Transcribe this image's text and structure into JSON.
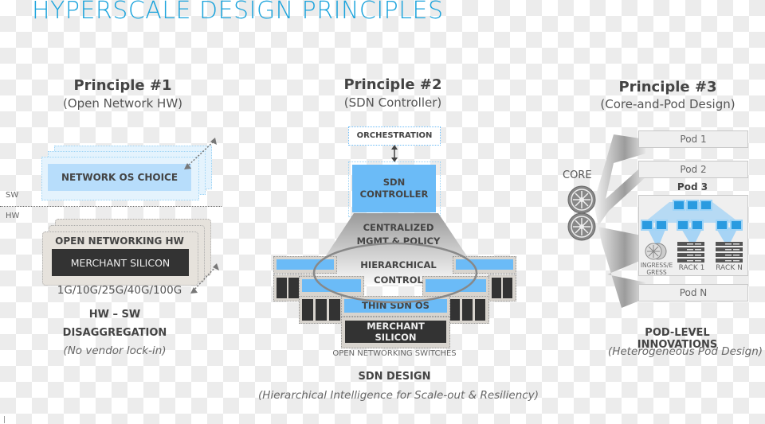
{
  "title": "HYPERSCALE DESIGN PRINCIPLES",
  "principle1": {
    "heading": "Principle #1",
    "subheading": "(Open Network HW)",
    "sw_label": "SW",
    "hw_label": "HW",
    "os_box": "NETWORK OS CHOICE",
    "hw_card": "OPEN NETWORKING HW",
    "silicon": "MERCHANT SILICON",
    "speeds": "1G/10G/25G/40G/100G",
    "caption_line1": "HW – SW",
    "caption_line2": "DISAGGREGATION",
    "note": "(No vendor lock-in)"
  },
  "principle2": {
    "heading": "Principle #2",
    "subheading": "(SDN Controller)",
    "orchestration": "ORCHESTRATION",
    "controller_line1": "SDN",
    "controller_line2": "CONTROLLER",
    "mgmt_line1": "CENTRALIZED",
    "mgmt_line2": "MGMT & POLICY",
    "control_line1": "HIERARCHICAL",
    "control_line2": "CONTROL",
    "thin_os": "THIN SDN OS",
    "silicon": "MERCHANT SILICON",
    "switches": "OPEN NETWORKING SWITCHES",
    "caption": "SDN DESIGN",
    "note": "(Hierarchical Intelligence for Scale-out & Resiliency)"
  },
  "principle3": {
    "heading": "Principle #3",
    "subheading": "(Core-and-Pod Design)",
    "core_label": "CORE",
    "pods": [
      "Pod 1",
      "Pod 2",
      "Pod N"
    ],
    "pod3_label": "Pod 3",
    "ingress": "INGRESS/E GRESS",
    "rack1": "RACK 1",
    "rackn": "RACK N",
    "caption": "POD-LEVEL INNOVATIONS",
    "note": "(Heterogeneous Pod Design)"
  },
  "colors": {
    "accent": "#1aa3dc",
    "light_blue": "#b7ddfb",
    "mid_blue": "#6bbbf7",
    "dark": "#333333"
  }
}
